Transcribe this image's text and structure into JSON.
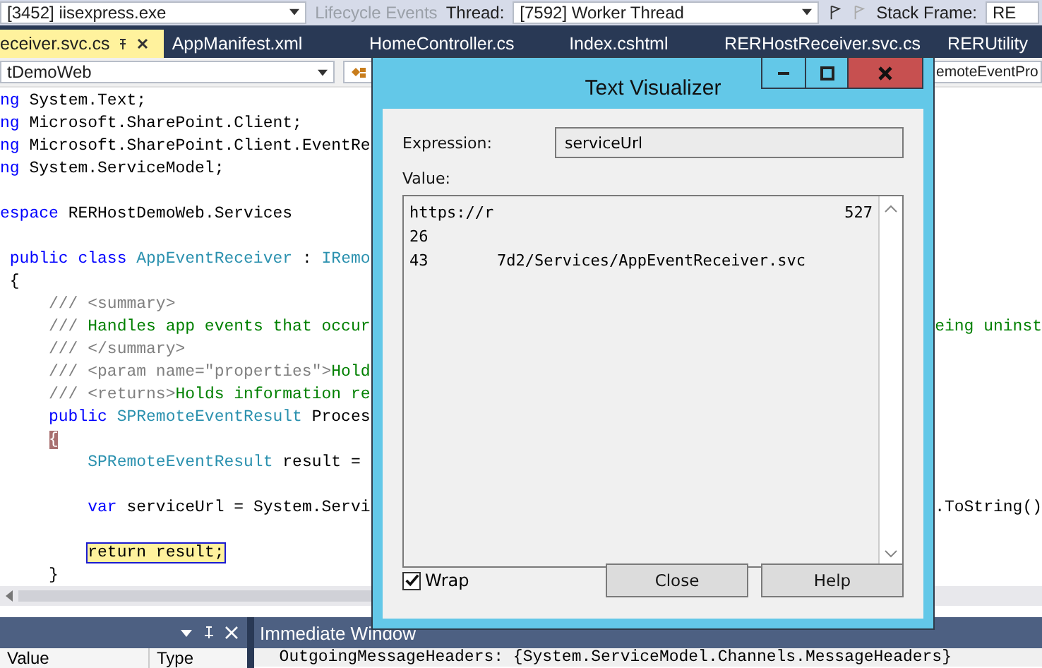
{
  "toolbar": {
    "process": "[3452] iisexpress.exe",
    "lifecycle_events": {
      "label": "Lifecycle Events",
      "disabled": true
    },
    "thread_label": "Thread:",
    "thread": "[7592] Worker Thread",
    "stack_frame_label": "Stack Frame:",
    "stack_frame": "RE"
  },
  "tabs": [
    {
      "label": "eceiver.svc.cs",
      "selected": true
    },
    {
      "label": "AppManifest.xml",
      "selected": false
    },
    {
      "label": "HomeController.cs",
      "selected": false
    },
    {
      "label": "Index.cshtml",
      "selected": false
    },
    {
      "label": "RERHostReceiver.svc.cs",
      "selected": false
    },
    {
      "label": "RERUtility",
      "selected": false
    }
  ],
  "nav_bar": {
    "project": "tDemoWeb",
    "member": "emoteEventPro"
  },
  "code_lines": [
    {
      "kind": "code",
      "tokens": [
        {
          "text": "ng",
          "kind": "keyword"
        },
        {
          "text": " System.Text;",
          "kind": "plain"
        }
      ]
    },
    {
      "kind": "code",
      "tokens": [
        {
          "text": "ng",
          "kind": "keyword"
        },
        {
          "text": " Microsoft.SharePoint.Client;",
          "kind": "plain"
        }
      ]
    },
    {
      "kind": "code",
      "tokens": [
        {
          "text": "ng",
          "kind": "keyword"
        },
        {
          "text": " Microsoft.SharePoint.Client.EventRe",
          "kind": "plain"
        }
      ]
    },
    {
      "kind": "code",
      "tokens": [
        {
          "text": "ng",
          "kind": "keyword"
        },
        {
          "text": " System.ServiceModel;",
          "kind": "plain"
        }
      ]
    },
    {
      "kind": "blank"
    },
    {
      "kind": "code",
      "tokens": [
        {
          "text": "espace",
          "kind": "keyword"
        },
        {
          "text": " RERHostDemoWeb.Services",
          "kind": "plain"
        }
      ]
    },
    {
      "kind": "blank"
    },
    {
      "kind": "code",
      "tokens": [
        {
          "text": " public class",
          "kind": "keyword"
        },
        {
          "text": " AppEventReceiver",
          "kind": "type"
        },
        {
          "text": " : ",
          "kind": "plain"
        },
        {
          "text": "IRemo",
          "kind": "type"
        }
      ]
    },
    {
      "kind": "code",
      "tokens": [
        {
          "text": " {",
          "kind": "plain"
        }
      ]
    },
    {
      "kind": "code",
      "tokens": [
        {
          "text": "     /// <summary>",
          "kind": "doc"
        }
      ]
    },
    {
      "kind": "code",
      "tokens": [
        {
          "text": "     ///",
          "kind": "doc"
        },
        {
          "text": " Handles app events that occur",
          "kind": "comment"
        }
      ],
      "right": [
        {
          "text": "eing uninst",
          "kind": "comment"
        }
      ]
    },
    {
      "kind": "code",
      "tokens": [
        {
          "text": "     /// </summary>",
          "kind": "doc"
        }
      ]
    },
    {
      "kind": "code",
      "tokens": [
        {
          "text": "     /// <param name=\"properties\">",
          "kind": "doc"
        },
        {
          "text": "Hold",
          "kind": "comment"
        }
      ]
    },
    {
      "kind": "code",
      "tokens": [
        {
          "text": "     /// <returns>",
          "kind": "doc"
        },
        {
          "text": "Holds information re",
          "kind": "comment"
        }
      ]
    },
    {
      "kind": "code",
      "tokens": [
        {
          "text": "     public",
          "kind": "keyword"
        },
        {
          "text": " SPRemoteEventResult",
          "kind": "type"
        },
        {
          "text": " Proces",
          "kind": "plain"
        }
      ]
    },
    {
      "kind": "code",
      "tokens": [
        {
          "text": "     {",
          "kind": "match"
        }
      ]
    },
    {
      "kind": "code",
      "tokens": [
        {
          "text": "         SPRemoteEventResult",
          "kind": "type"
        },
        {
          "text": " result =",
          "kind": "plain"
        }
      ]
    },
    {
      "kind": "blank"
    },
    {
      "kind": "code",
      "tokens": [
        {
          "text": "         var",
          "kind": "keyword"
        },
        {
          "text": " serviceUrl = System.Servi",
          "kind": "plain"
        }
      ],
      "right": [
        {
          "text": ".ToString()",
          "kind": "plain"
        }
      ]
    },
    {
      "kind": "blank"
    },
    {
      "kind": "code",
      "tokens": [
        {
          "text": "         return result;",
          "kind": "current"
        }
      ]
    },
    {
      "kind": "code",
      "tokens": [
        {
          "text": "     }",
          "kind": "plain"
        }
      ]
    }
  ],
  "locals_panel": {
    "columns": [
      "Value",
      "Type"
    ]
  },
  "immediate_window": {
    "title": "Immediate Window",
    "lines": [
      "  OutgoingMessageHeaders: {System.ServiceModel.Channels.MessageHeaders}"
    ]
  },
  "dialog": {
    "title": "Text Visualizer",
    "expression_label": "Expression:",
    "expression": "serviceUrl",
    "value_label": "Value:",
    "value_lines": [
      {
        "parts": [
          {
            "text": "https://r",
            "kind": "start"
          },
          {
            "text": "527",
            "kind": "end"
          }
        ]
      },
      {
        "parts": [
          {
            "text": "26",
            "kind": "start"
          }
        ]
      },
      {
        "parts": [
          {
            "text": "43",
            "kind": "start"
          },
          {
            "text": "7d2/Services/AppEventReceiver.svc",
            "kind": "middle"
          }
        ]
      }
    ],
    "wrap": {
      "label": "Wrap",
      "checked": true
    },
    "buttons": [
      "Close",
      "Help"
    ]
  }
}
